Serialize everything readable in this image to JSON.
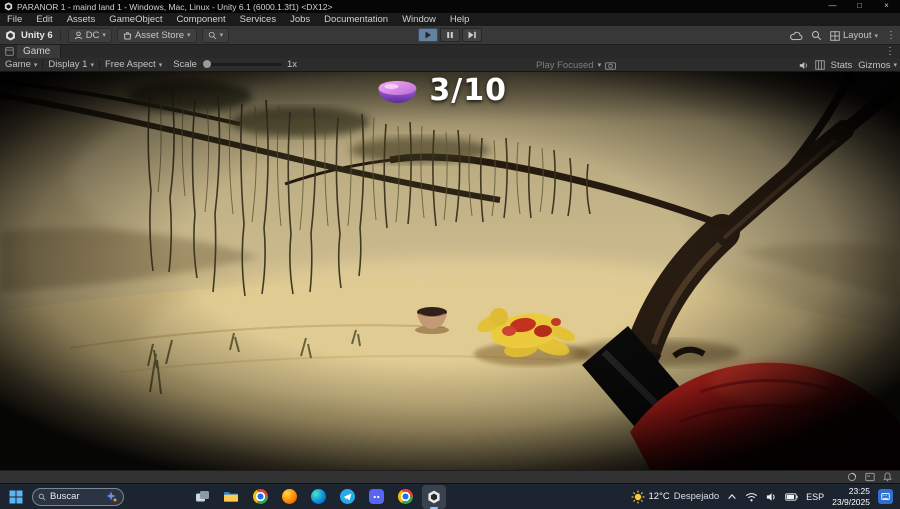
{
  "window": {
    "title": "PARANOR 1 - maind land 1 - Windows, Mac, Linux - Unity 6.1 (6000.1.3f1) <DX12>"
  },
  "icons": {
    "chevron_down": "▾",
    "more_vertical": "⋮",
    "minimize": "—",
    "maximize": "□",
    "close": "×"
  },
  "menubar": {
    "items": [
      "File",
      "Edit",
      "Assets",
      "GameObject",
      "Component",
      "Services",
      "Jobs",
      "Documentation",
      "Window",
      "Help"
    ]
  },
  "toolbar": {
    "version_label": "Unity 6",
    "account_label": "DC",
    "asset_store_label": "Asset Store",
    "layout_label": "Layout"
  },
  "game_tab": {
    "label": "Game"
  },
  "game_toolbar": {
    "view_menu": "Game",
    "display": "Display 1",
    "aspect": "Free Aspect",
    "scale_label": "Scale",
    "scale_value": "1x",
    "play_focused": "Play Focused",
    "stats_label": "Stats",
    "gizmos_label": "Gizmos"
  },
  "hud": {
    "counter": "3/10"
  },
  "taskbar": {
    "search_placeholder": "Buscar",
    "weather_temp": "12°C",
    "weather_desc": "Despejado",
    "language": "ESP",
    "time": "23:25",
    "date": "23/9/2025"
  },
  "colors": {
    "play_highlight": "#64829e",
    "hud_text": "#ffffff",
    "taskbar_badge": "#2f6fd0",
    "hud_bowl_pink": "#f2a0e8",
    "hud_bowl_purple": "#8a3fc0"
  }
}
